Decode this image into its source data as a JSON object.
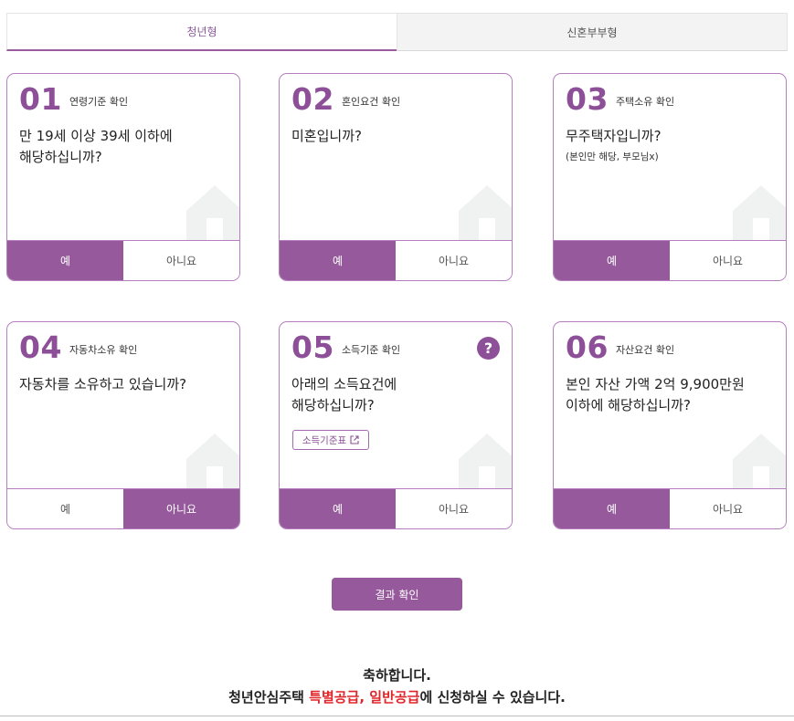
{
  "tabs": [
    {
      "label": "청년형",
      "active": true
    },
    {
      "label": "신혼부부형",
      "active": false
    }
  ],
  "cards": [
    {
      "num": "01",
      "title": "연령기준 확인",
      "question_lines": [
        "만 19세 이상 39세 이하에",
        "해당하십니까?"
      ],
      "yes": "예",
      "no": "아니요",
      "selected": "yes"
    },
    {
      "num": "02",
      "title": "혼인요건 확인",
      "question_lines": [
        "미혼입니까?"
      ],
      "yes": "예",
      "no": "아니요",
      "selected": "yes"
    },
    {
      "num": "03",
      "title": "주택소유 확인",
      "question_lines": [
        "무주택자입니까?"
      ],
      "note": "(본인만 해당, 부모님x)",
      "yes": "예",
      "no": "아니요",
      "selected": "yes"
    },
    {
      "num": "04",
      "title": "자동차소유 확인",
      "question_lines": [
        "자동차를 소유하고 있습니까?"
      ],
      "yes": "예",
      "no": "아니요",
      "selected": "no"
    },
    {
      "num": "05",
      "title": "소득기준 확인",
      "question_lines": [
        "아래의 소득요건에",
        "해당하십니까?"
      ],
      "link_label": "소득기준표",
      "help_icon": "?",
      "yes": "예",
      "no": "아니요",
      "selected": "yes"
    },
    {
      "num": "06",
      "title": "자산요건 확인",
      "question_lines": [
        "본인 자산 가액 2억 9,900만원",
        "이하에 해당하십니까?"
      ],
      "yes": "예",
      "no": "아니요",
      "selected": "yes"
    }
  ],
  "result_button": "결과 확인",
  "congrats": {
    "line1": "축하합니다.",
    "line2_prefix": "청년안심주택 ",
    "line2_highlight1": "특별공급",
    "line2_sep": ", ",
    "line2_highlight2": "일반공급",
    "line2_suffix": "에 신청하실 수 있습니다."
  },
  "colors": {
    "accent": "#965a9c",
    "number": "#8d4f98",
    "highlight": "#e0262a",
    "house": "#f0f1f1"
  },
  "icons": {
    "house": "house-icon",
    "help": "question-icon",
    "external": "external-link-icon"
  }
}
